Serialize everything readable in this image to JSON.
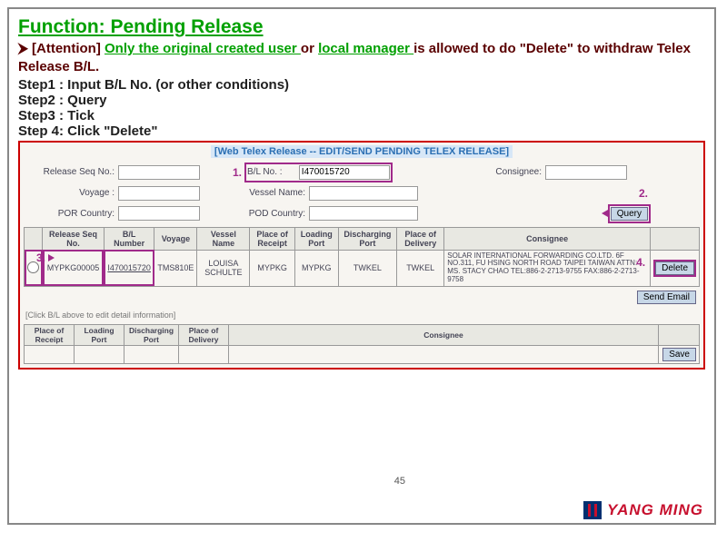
{
  "title": "Function: Pending Release",
  "attention": {
    "lead": "⮞ [Attention] ",
    "link1": "Only the original created user ",
    "mid": "or ",
    "link2": "local manager ",
    "tail": "is allowed to do \"Delete\" to withdraw Telex Release B/L."
  },
  "steps": {
    "s1": "Step1 : Input B/L No. (or other conditions)",
    "s2": "Step2 : Query",
    "s3": "Step3 : Tick",
    "s4": "Step 4: Click \"Delete\""
  },
  "app": {
    "title": "[Web Telex Release -- EDIT/SEND PENDING TELEX RELEASE]",
    "labels": {
      "release_seq": "Release Seq No.:",
      "bl_no": "B/L No. :",
      "consignee": "Consignee:",
      "voyage": "Voyage :",
      "vessel_name": "Vessel Name:",
      "por_country": "POR Country:",
      "pod_country": "POD Country:"
    },
    "values": {
      "bl_no": "I470015720"
    },
    "buttons": {
      "query": "Query",
      "delete": "Delete",
      "send_email": "Send Email",
      "save": "Save"
    },
    "callouts": {
      "c1": "1.",
      "c2": "2.",
      "c3": "3.",
      "c4": "4."
    },
    "table": {
      "headers": {
        "seq": "Release Seq No.",
        "bl": "B/L Number",
        "voyage": "Voyage",
        "vessel": "Vessel Name",
        "por": "Place of Receipt",
        "load": "Loading Port",
        "dis": "Discharging Port",
        "del": "Place of Delivery",
        "cons": "Consignee"
      },
      "row": {
        "seq": "MYPKG00005",
        "bl": "I470015720",
        "voyage": "TMS810E",
        "vessel": "LOUISA SCHULTE",
        "por": "MYPKG",
        "load": "MYPKG",
        "dis": "TWKEL",
        "del": "TWKEL",
        "consignee": "SOLAR INTERNATIONAL FORWARDING CO.LTD. 6F NO.311, FU HSING NORTH ROAD TAIPEI TAIWAN ATTN: MS. STACY CHAO TEL:886-2-2713-9755 FAX:886-2-2713-9758"
      }
    },
    "hint": "[Click B/L above to edit detail information]",
    "lower_headers": {
      "por": "Place of Receipt",
      "load": "Loading Port",
      "dis": "Discharging Port",
      "del": "Place of Delivery",
      "cons": "Consignee"
    }
  },
  "page_number": "45",
  "brand": "YANG MING"
}
